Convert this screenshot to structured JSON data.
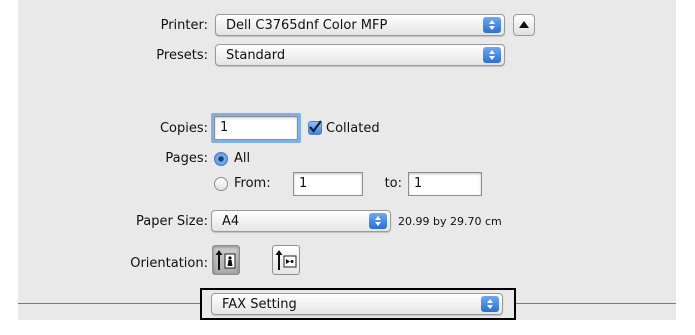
{
  "printer": {
    "label": "Printer:",
    "value": "Dell C3765dnf Color MFP"
  },
  "presets": {
    "label": "Presets:",
    "value": "Standard"
  },
  "copies": {
    "label": "Copies:",
    "value": "1",
    "collated_label": "Collated",
    "collated_checked": true
  },
  "pages": {
    "label": "Pages:",
    "all_label": "All",
    "from_label": "From:",
    "from_value": "1",
    "to_label": "to:",
    "to_value": "1",
    "selected": "All"
  },
  "paper_size": {
    "label": "Paper Size:",
    "value": "A4",
    "dimensions": "20.99 by 29.70 cm"
  },
  "orientation": {
    "label": "Orientation:",
    "selected": "portrait"
  },
  "section_menu": {
    "value": "FAX Setting"
  },
  "colors": {
    "accent": "#3f84dc",
    "focus": "#7fb0ea",
    "dialog_bg": "#e9e9e9"
  }
}
